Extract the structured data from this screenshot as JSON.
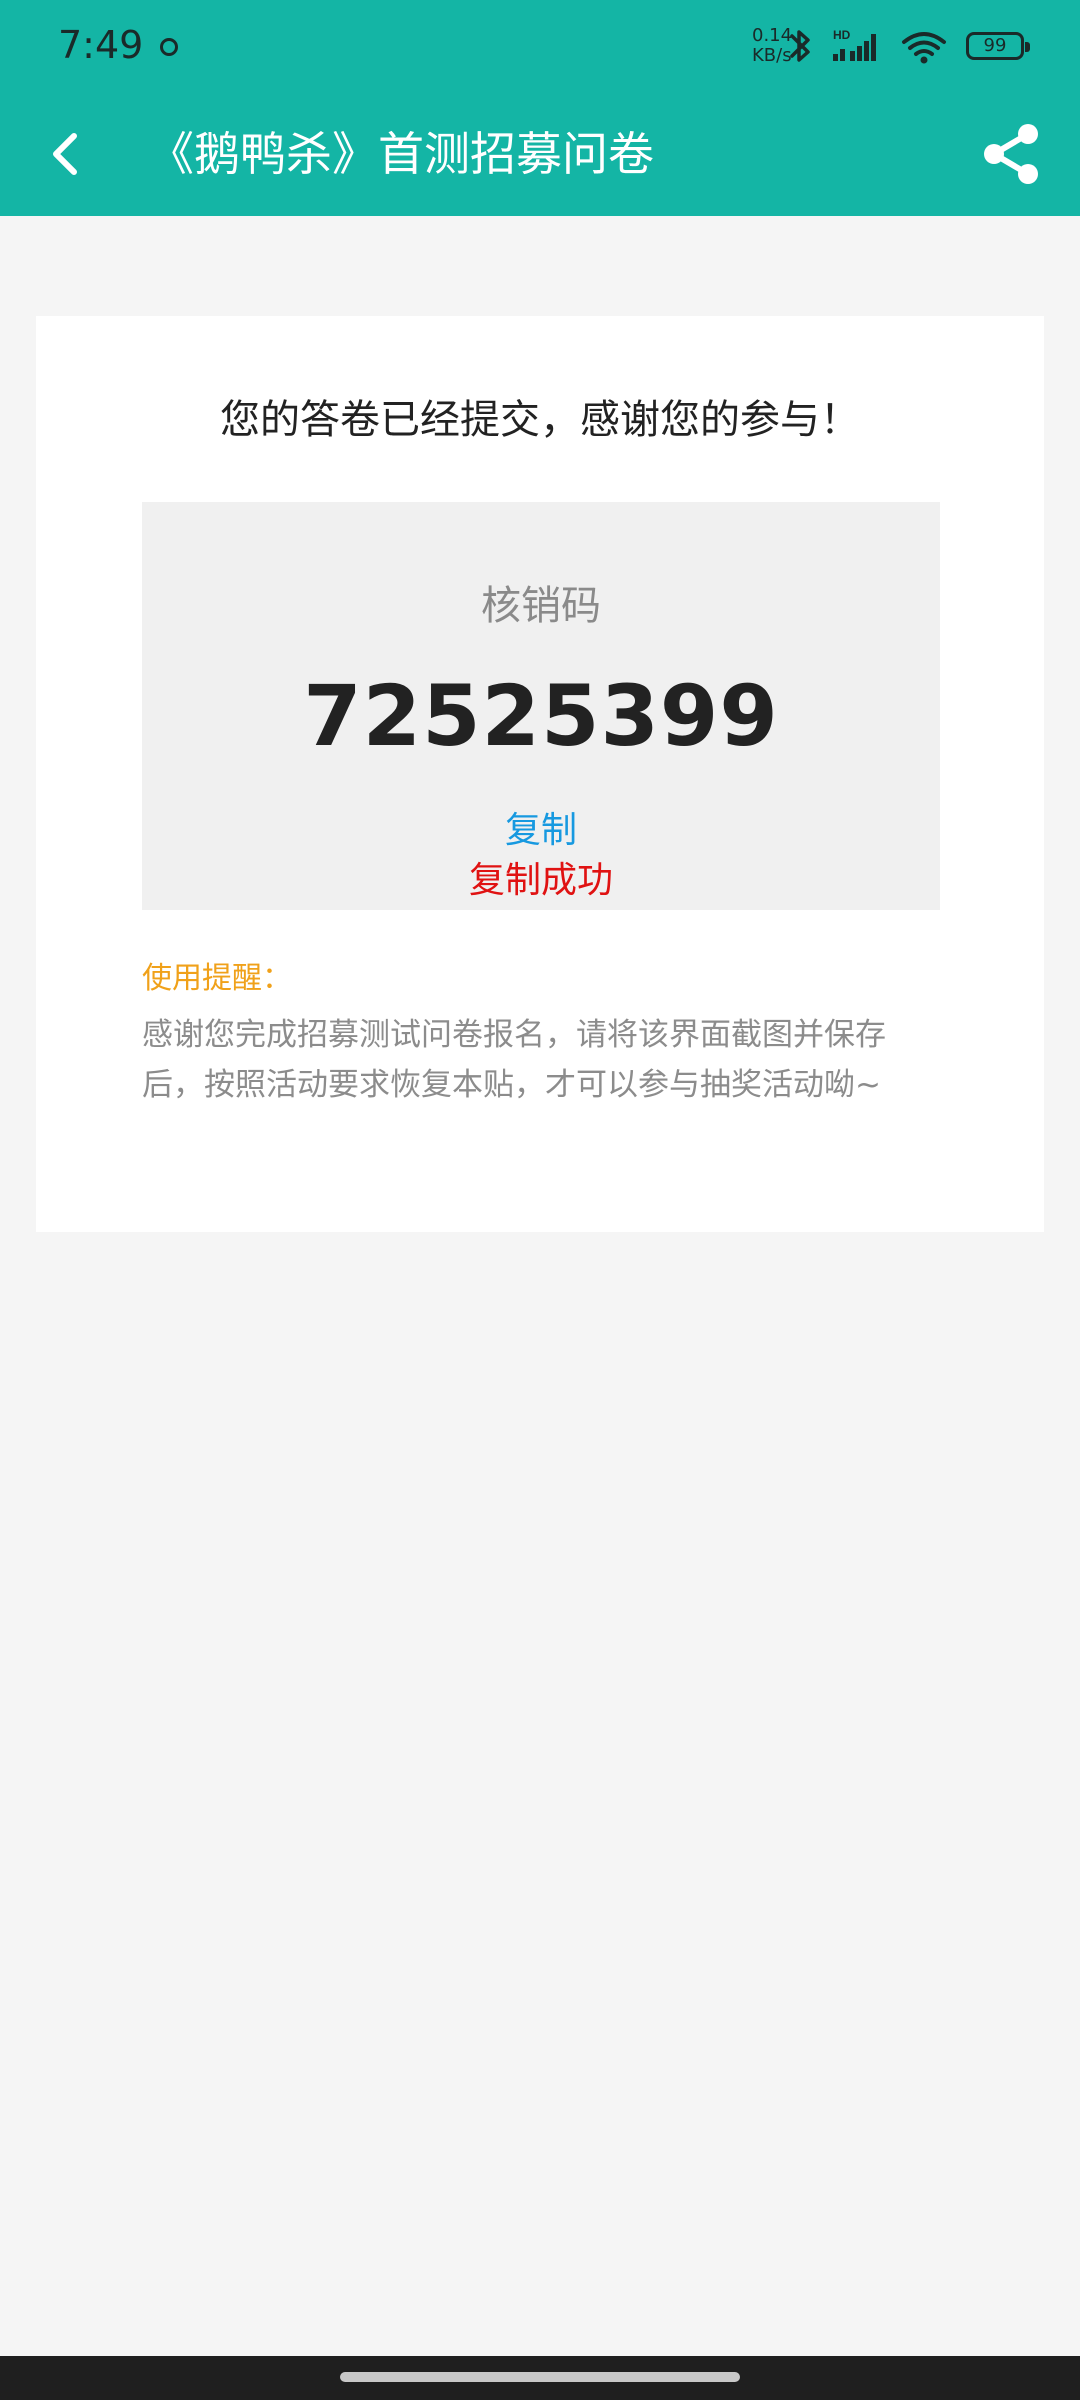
{
  "status_bar": {
    "time": "7:49",
    "network_speed": "0.14\nKB/s",
    "battery": "99",
    "icons": [
      "notification-dot-icon",
      "bluetooth-icon",
      "hd-signal-icon",
      "wifi-icon",
      "battery-icon"
    ]
  },
  "header": {
    "title": "《鹅鸭杀》首测招募问卷",
    "back_icon": "back-arrow-icon",
    "share_icon": "share-icon",
    "background": "#14b5a5"
  },
  "result": {
    "message": "您的答卷已经提交，感谢您的参与！",
    "code_label": "核销码",
    "code": "72525399",
    "copy_label": "复制",
    "copy_success": "复制成功"
  },
  "tips": {
    "title": "使用提醒：",
    "text": "感谢您完成招募测试问卷报名，请将该界面截图并保存后，按照活动要求恢复本贴，才可以参与抽奖活动呦~"
  },
  "colors": {
    "accent": "#14b5a5",
    "copy_link": "#1799e0",
    "success": "#e01212",
    "tip_title": "#f0a11a"
  }
}
